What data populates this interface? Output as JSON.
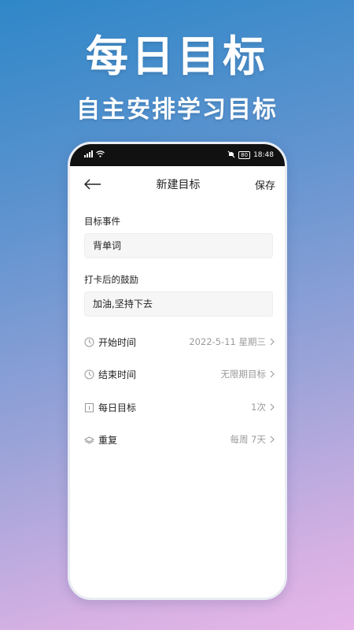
{
  "hero": {
    "title": "每日目标",
    "subtitle": "自主安排学习目标"
  },
  "status_bar": {
    "time": "18:48",
    "battery": "80",
    "icons": [
      "signal-icon",
      "wifi-icon",
      "mute-icon",
      "battery-icon"
    ]
  },
  "nav": {
    "back_icon": "back-arrow-icon",
    "title": "新建目标",
    "save_label": "保存"
  },
  "form": {
    "event_label": "目标事件",
    "event_value": "背单词",
    "reward_label": "打卡后的鼓励",
    "reward_value": "加油,坚持下去"
  },
  "settings": [
    {
      "icon": "clock-icon",
      "label": "开始时间",
      "value": "2022-5-11 星期三"
    },
    {
      "icon": "clock-icon",
      "label": "结束时间",
      "value": "无限期目标"
    },
    {
      "icon": "calendar-icon",
      "label": "每日目标",
      "value": "1次"
    },
    {
      "icon": "layers-icon",
      "label": "重复",
      "value": "每周 7天"
    }
  ],
  "colors": {
    "gradient_top": "#2f87c8",
    "gradient_bottom": "#e6b6e8",
    "text_primary": "#222222",
    "text_secondary": "#9a9a9a",
    "input_bg": "#f6f6f7"
  }
}
